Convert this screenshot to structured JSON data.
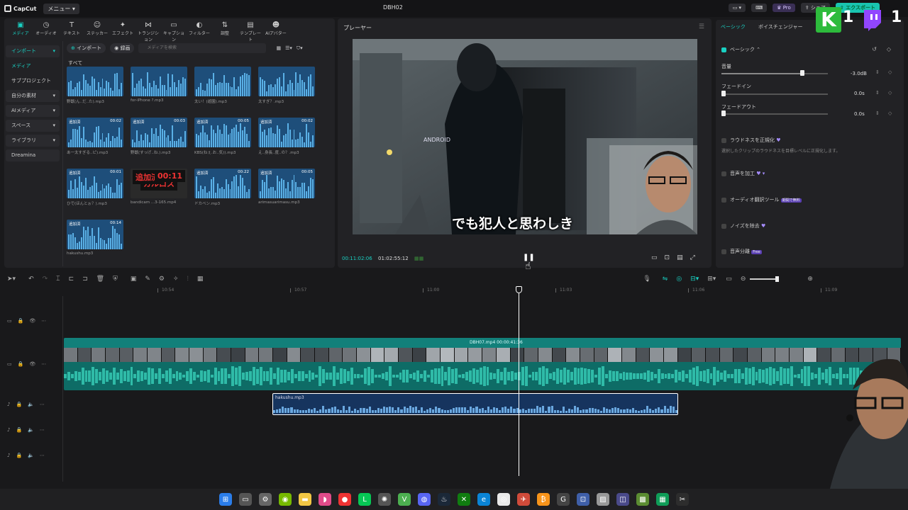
{
  "app": {
    "name": "CapCut",
    "menu": "メニュー",
    "project": "DBH02",
    "pro": "Pro",
    "share": "シェア",
    "export": "エクスポート"
  },
  "toolbar_tabs": [
    {
      "label": "メディア",
      "icon": "media-icon"
    },
    {
      "label": "オーディオ",
      "icon": "audio-icon"
    },
    {
      "label": "テキスト",
      "icon": "text-icon"
    },
    {
      "label": "ステッカー",
      "icon": "sticker-icon"
    },
    {
      "label": "エフェクト",
      "icon": "effect-icon"
    },
    {
      "label": "トランジション",
      "icon": "transition-icon"
    },
    {
      "label": "キャプション",
      "icon": "caption-icon"
    },
    {
      "label": "フィルター",
      "icon": "filter-icon"
    },
    {
      "label": "調整",
      "icon": "adjust-icon"
    },
    {
      "label": "テンプレート",
      "icon": "template-icon"
    },
    {
      "label": "AIアバター",
      "icon": "avatar-icon"
    }
  ],
  "sidebar": [
    "インポート",
    "メディア",
    "サブプロジェクト",
    "自分の素材",
    "AIメディア",
    "スペース",
    "ライブラリ",
    "Dreamina"
  ],
  "media_bar": {
    "import": "インポート",
    "record": "録画",
    "search_placeholder": "メディアを検索",
    "all": "すべて"
  },
  "media": [
    {
      "name": "野獣(ん..だ..た).mp3",
      "badge": "",
      "dur": ""
    },
    {
      "name": "for-iPhone ?.mp3",
      "badge": "",
      "dur": ""
    },
    {
      "name": "太い！(遊園).mp3",
      "badge": "",
      "dur": ""
    },
    {
      "name": "太すぎ？.mp3",
      "badge": "",
      "dur": ""
    },
    {
      "name": "あ一太すぎる..ピ).mp3",
      "badge": "追加済",
      "dur": "00:02"
    },
    {
      "name": "野獣(すっげ..ね.).mp3",
      "badge": "追加済",
      "dur": "00:03"
    },
    {
      "name": "KBS(ねぇ.お..気)).mp3",
      "badge": "追加済",
      "dur": "00:05"
    },
    {
      "name": "え..身長..度..の？.mp3",
      "badge": "追加済",
      "dur": "00:02"
    },
    {
      "name": "ひで(ほんとぉ？).mp3",
      "badge": "追加済",
      "dur": "00:01"
    },
    {
      "name": "bandicam ...3-165.mp4",
      "badge": "追加済",
      "dur": "00:11",
      "karu": "カルロス"
    },
    {
      "name": "ドカベン.mp3",
      "badge": "追加済",
      "dur": "00:22"
    },
    {
      "name": "arimasuarimasu.mp3",
      "badge": "追加済",
      "dur": "00:05"
    },
    {
      "name": "hakushu.mp3",
      "badge": "追加済",
      "dur": "00:14"
    }
  ],
  "player": {
    "title": "プレーヤー",
    "time_current": "00:11:02:06",
    "time_total": "01:02:55:12",
    "subtitle": "でも犯人と思わしき",
    "android_text": "ANDROID"
  },
  "right_panel": {
    "tabs": [
      "ベーシック",
      "ボイスチェンジャー"
    ],
    "basic": "ベーシック",
    "volume_label": "音量",
    "volume_value": "-3.0dB",
    "volume_level": 0.76,
    "fadein_label": "フェードイン",
    "fadein_value": "0.0s",
    "fadeout_label": "フェードアウト",
    "fadeout_value": "0.0s",
    "loudness": "ラウドネスを正規化",
    "loudness_desc": "選択したクリップのラウドネスを目標レベルに正規化します。",
    "voice_process": "音声を加工",
    "audio_translate": "オーディオ翻訳ツール",
    "translate_badge": "期間で無料",
    "noise": "ノイズを除去",
    "separate": "音声分離",
    "separate_badge": "Free"
  },
  "timeline": {
    "ruler": [
      "10:54",
      "10:57",
      "11:00",
      "11:03",
      "11:06",
      "11:09"
    ],
    "main_clip": "DBH07.mp4  00:00:41:36",
    "audio_clip": "hakushu.mp3"
  },
  "overlay": {
    "k_letter": "K",
    "k_num": "1",
    "t_num": "1"
  },
  "taskbar_icons": [
    "windows-icon",
    "files-icon",
    "settings-icon",
    "nvidia-icon",
    "folder-icon",
    "lips-icon",
    "record-icon",
    "line-icon",
    "chatgpt-icon",
    "vegas-icon",
    "discord-icon",
    "steam-icon",
    "xbox-icon",
    "edge-icon",
    "chrome-icon",
    "app-icon",
    "bitcoin-icon",
    "g-icon",
    "capture-icon",
    "image-icon",
    "app2-icon",
    "minecraft-icon",
    "sheets-icon",
    "capcut-icon"
  ]
}
